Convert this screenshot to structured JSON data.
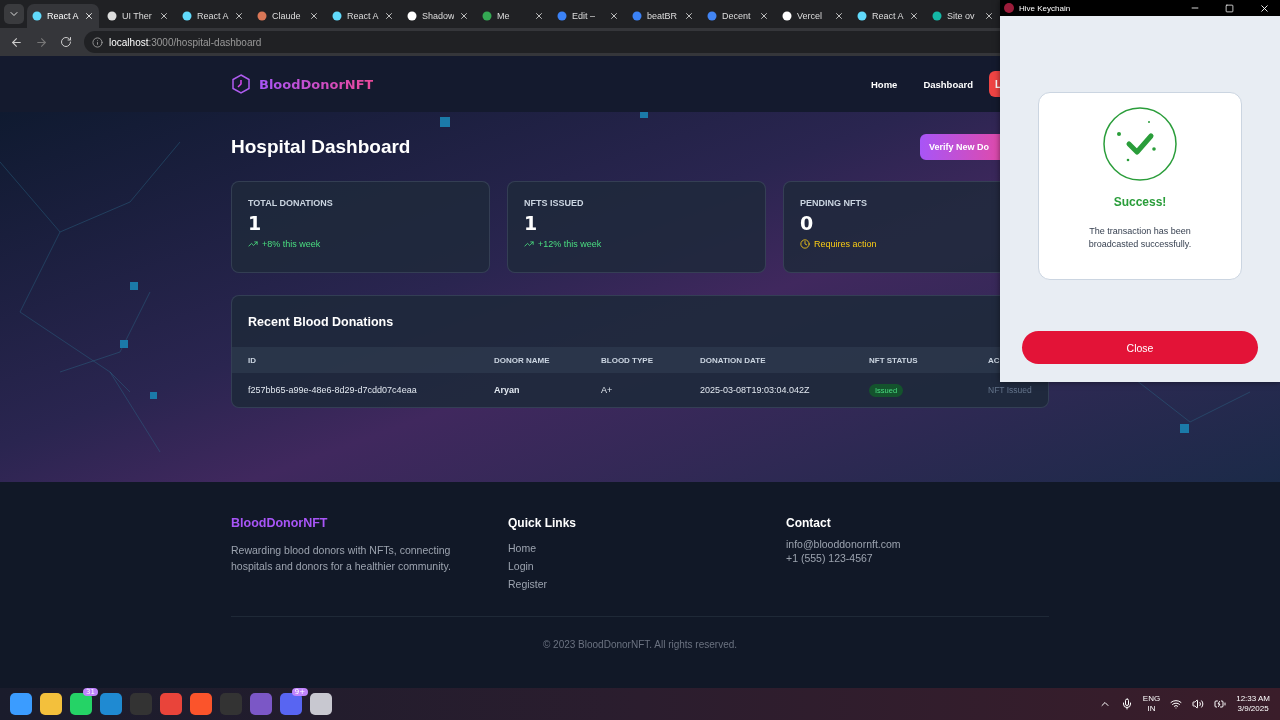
{
  "browser": {
    "tabs": [
      {
        "label": "React A",
        "kind": "react",
        "selected": true
      },
      {
        "label": "UI Ther",
        "kind": "theme",
        "selected": false
      },
      {
        "label": "React A",
        "kind": "react",
        "selected": false
      },
      {
        "label": "Claude",
        "kind": "claude",
        "selected": false
      },
      {
        "label": "React A",
        "kind": "react",
        "selected": false
      },
      {
        "label": "Shadow",
        "kind": "github",
        "selected": false
      },
      {
        "label": "Me",
        "kind": "meet",
        "selected": false
      },
      {
        "label": "Edit –",
        "kind": "edit",
        "selected": false
      },
      {
        "label": "beatBR",
        "kind": "edit",
        "selected": false
      },
      {
        "label": "Decent",
        "kind": "doc",
        "selected": false
      },
      {
        "label": "Vercel",
        "kind": "vercel",
        "selected": false
      },
      {
        "label": "React A",
        "kind": "react",
        "selected": false
      },
      {
        "label": "Site ov",
        "kind": "site",
        "selected": false
      }
    ],
    "url_host": "localhost",
    "url_path": ":3000/hospital-dashboard"
  },
  "nav": {
    "brand": "BloodDonorNFT",
    "links": [
      "Home",
      "Dashboard"
    ],
    "button": "L"
  },
  "header": {
    "title": "Hospital Dashboard",
    "button": "Verify New Do"
  },
  "stats": [
    {
      "label": "TOTAL DONATIONS",
      "value": "1",
      "note": "+8% this week",
      "kind": "up"
    },
    {
      "label": "NFTS ISSUED",
      "value": "1",
      "note": "+12% this week",
      "kind": "up"
    },
    {
      "label": "PENDING NFTS",
      "value": "0",
      "note": "Requires action",
      "kind": "pending"
    }
  ],
  "donations": {
    "title": "Recent Blood Donations",
    "columns": [
      "ID",
      "DONOR NAME",
      "BLOOD TYPE",
      "DONATION DATE",
      "NFT STATUS",
      "AC"
    ],
    "rows": [
      {
        "id": "f257bb65-a99e-48e6-8d29-d7cdd07c4eaa",
        "donor": "Aryan",
        "blood_type": "A+",
        "date": "2025-03-08T19:03:04.042Z",
        "status": "Issued",
        "action": "NFT Issued"
      }
    ]
  },
  "footer": {
    "brand": "BloodDonorNFT",
    "tagline": "Rewarding blood donors with NFTs, connecting hospitals and donors for a healthier community.",
    "quick_links_title": "Quick Links",
    "quick_links": [
      "Home",
      "Login",
      "Register"
    ],
    "contact_title": "Contact",
    "contact": [
      "info@blooddonornft.com",
      "+1 (555) 123-4567"
    ],
    "copyright": "© 2023 BloodDonorNFT. All rights reserved."
  },
  "keychain": {
    "title": "Hive Keychain",
    "heading": "Success!",
    "message": "The transaction has been broadcasted successfully.",
    "button": "Close"
  },
  "taskbar": {
    "apps": [
      {
        "kind": "start"
      },
      {
        "kind": "folder"
      },
      {
        "kind": "chat",
        "badge": "31"
      },
      {
        "kind": "code"
      },
      {
        "kind": "terminal"
      },
      {
        "kind": "chrome"
      },
      {
        "kind": "brave"
      },
      {
        "kind": "terminal"
      },
      {
        "kind": "studio"
      },
      {
        "kind": "discord",
        "badge": "9+"
      },
      {
        "kind": "rocket"
      }
    ],
    "lang": "ENG",
    "region": "IN",
    "time": "12:33 AM",
    "date": "3/9/2025"
  }
}
